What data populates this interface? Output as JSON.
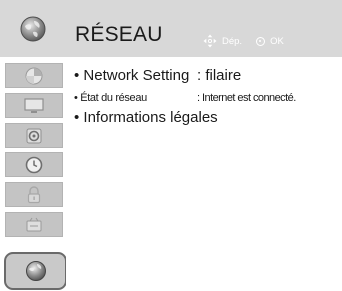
{
  "header": {
    "title": "RÉSEAU",
    "move_hint": "Dép.",
    "ok_hint": "OK"
  },
  "sidebar": {
    "items": [
      {
        "icon": "picture-icon"
      },
      {
        "icon": "screen-icon"
      },
      {
        "icon": "audio-icon"
      },
      {
        "icon": "clock-icon"
      },
      {
        "icon": "lock-icon"
      },
      {
        "icon": "options-icon"
      },
      {
        "icon": "network-icon",
        "selected": true
      }
    ]
  },
  "menu": {
    "items": [
      {
        "label": "• Network Setting",
        "value": ": filaire"
      },
      {
        "label": "• État du réseau",
        "value": ": Internet est connecté."
      },
      {
        "label": "• Informations légales"
      }
    ]
  },
  "colors": {
    "header_bg": "#d8d8d8",
    "tile_bg": "#c4c4c4",
    "selected_border": "#6a6a6a",
    "text": "#1a1a1a",
    "hint_text": "#ffffff"
  }
}
